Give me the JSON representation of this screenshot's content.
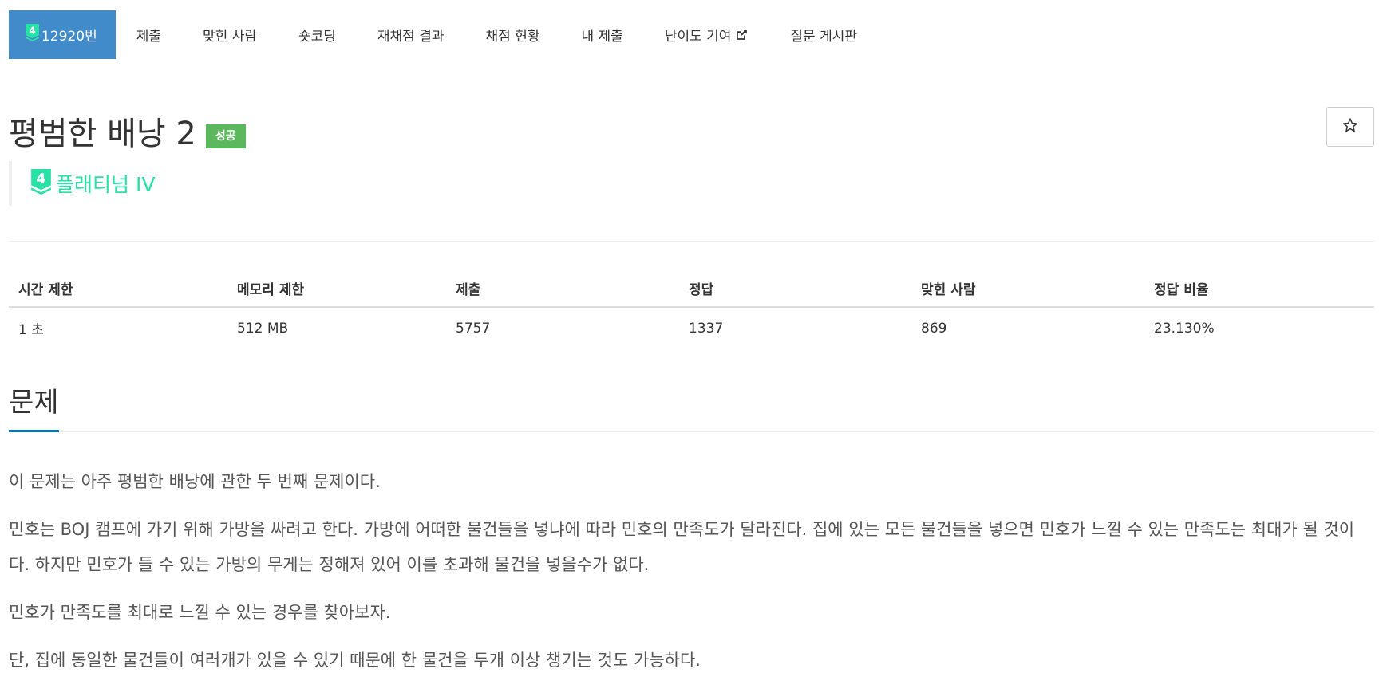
{
  "tabs": {
    "problem_id": "12920번",
    "tier_number": "4",
    "items": [
      "제출",
      "맞힌 사람",
      "숏코딩",
      "재채점 결과",
      "채점 현황",
      "내 제출",
      "난이도 기여",
      "질문 게시판"
    ]
  },
  "problem": {
    "title": "평범한 배낭 2",
    "status_label": "성공",
    "tier_number": "4",
    "tier_label": "플래티넘 IV"
  },
  "stats": {
    "headers": [
      "시간 제한",
      "메모리 제한",
      "제출",
      "정답",
      "맞힌 사람",
      "정답 비율"
    ],
    "values": [
      "1 초",
      "512 MB",
      "5757",
      "1337",
      "869",
      "23.130%"
    ]
  },
  "section": {
    "title": "문제"
  },
  "description": [
    "이 문제는 아주 평범한 배낭에 관한 두 번째 문제이다.",
    "민호는 BOJ 캠프에 가기 위해 가방을 싸려고 한다. 가방에 어떠한 물건들을 넣냐에 따라 민호의 만족도가 달라진다. 집에 있는 모든 물건들을 넣으면 민호가 느낄 수 있는 만족도는 최대가 될 것이다. 하지만 민호가 들 수 있는 가방의 무게는 정해져 있어 이를 초과해 물건을 넣을수가 없다.",
    "민호가 만족도를 최대로 느낄 수 있는 경우를 찾아보자.",
    "단, 집에 동일한 물건들이 여러개가 있을 수 있기 때문에 한 물건을 두개 이상 챙기는 것도 가능하다."
  ],
  "colors": {
    "tab_active_bg": "#428bca",
    "status_green": "#5cb85c",
    "platinum": "#27e2a4",
    "section_underline": "#0076c0"
  },
  "icons": {
    "tier_badge": "platinum-tier-icon",
    "external_link": "external-link-icon",
    "favorite": "star-icon"
  }
}
